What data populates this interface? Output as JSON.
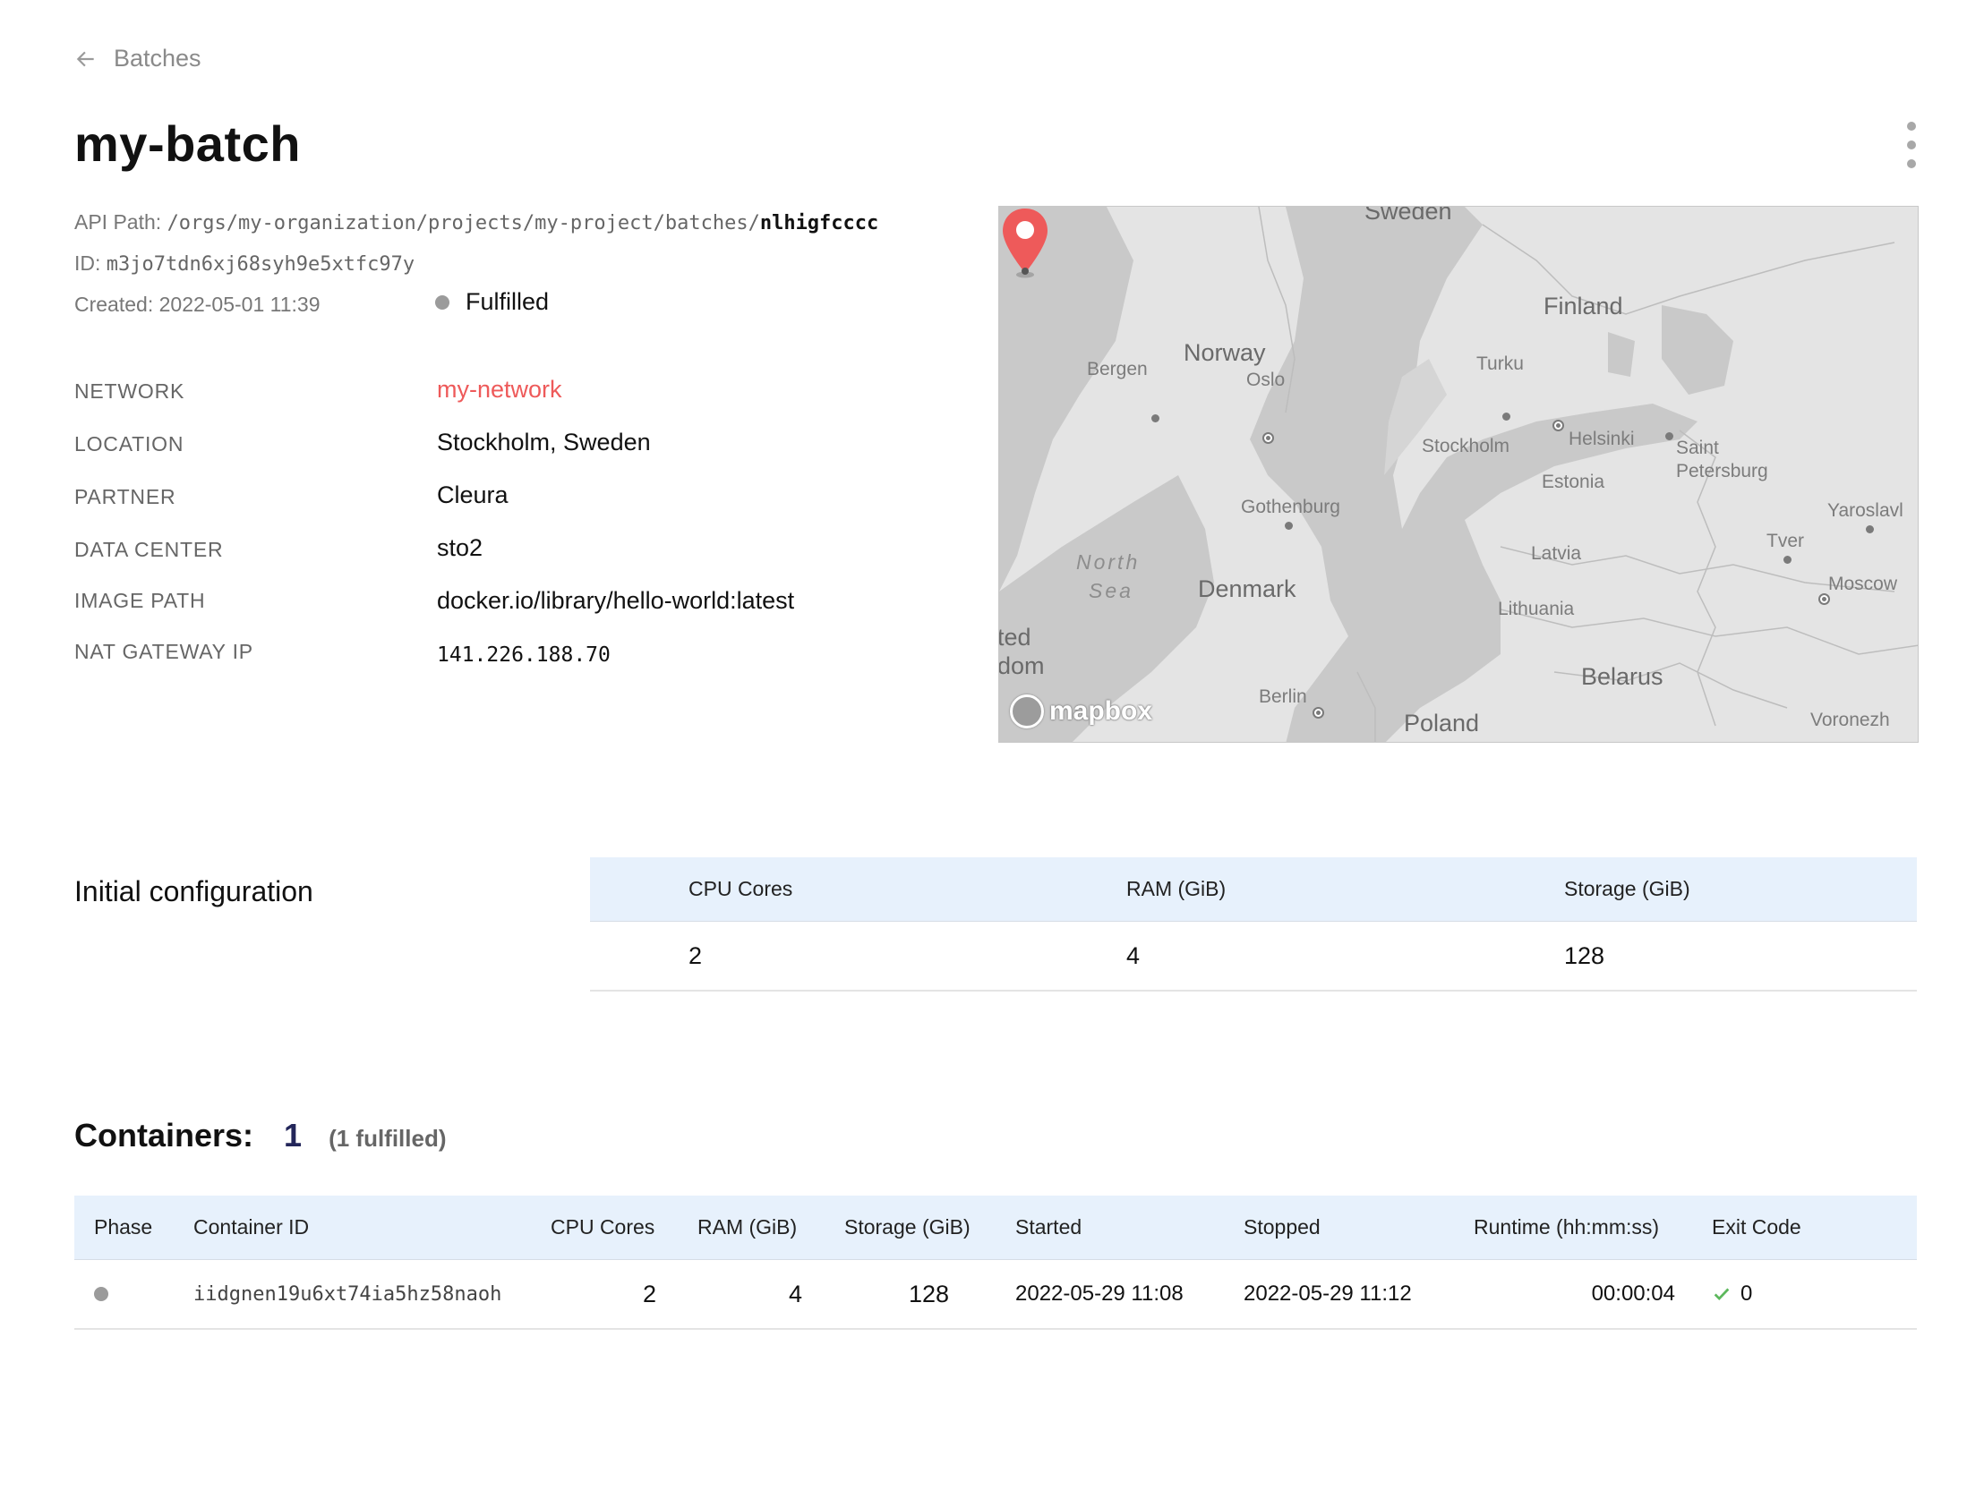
{
  "breadcrumb": {
    "back_label": "Batches"
  },
  "page": {
    "title": "my-batch"
  },
  "meta": {
    "api_path_label": "API Path:",
    "api_path_prefix": "/orgs/my-organization/projects/my-project/batches/",
    "api_path_id": "nlhigfcccc",
    "id_label": "ID:",
    "id_value": "m3jo7tdn6xj68syh9e5xtfc97y",
    "created": "Created: 2022-05-01 11:39",
    "status": "Fulfilled",
    "status_color": "#9b9b9b"
  },
  "properties": [
    {
      "label": "NETWORK",
      "value": "my-network"
    },
    {
      "label": "LOCATION",
      "value": "Stockholm, Sweden"
    },
    {
      "label": "PARTNER",
      "value": "Cleura"
    },
    {
      "label": "DATA CENTER",
      "value": "sto2"
    },
    {
      "label": "IMAGE PATH",
      "value": "docker.io/library/hello-world:latest"
    },
    {
      "label": "NAT GATEWAY IP",
      "value": "141.226.188.70"
    }
  ],
  "map": {
    "labels": {
      "sweden": "Sweden",
      "finland": "Finland",
      "norway": "Norway",
      "bergen": "Bergen",
      "oslo": "Oslo",
      "turku": "Turku",
      "helsinki": "Helsinki",
      "stockholm": "Stockholm",
      "saint": "Saint",
      "petersburg": "Petersburg",
      "estonia": "Estonia",
      "gothenburg": "Gothenburg",
      "yaroslavl": "Yaroslavl",
      "tver": "Tver",
      "latvia": "Latvia",
      "north": "North",
      "sea": "Sea",
      "denmark": "Denmark",
      "moscow": "Moscow",
      "lithuania": "Lithuania",
      "ted": "ted",
      "dom": "dom",
      "belarus": "Belarus",
      "berlin": "Berlin",
      "poland": "Poland",
      "voronezh": "Voronezh"
    },
    "logo_text": "mapbox",
    "marker_color": "#ee5a5a"
  },
  "initial_configuration": {
    "title": "Initial configuration",
    "headers": [
      "CPU Cores",
      "RAM (GiB)",
      "Storage (GiB)"
    ],
    "values": [
      "2",
      "4",
      "128"
    ]
  },
  "containers": {
    "title": "Containers:",
    "count": "1",
    "subtitle": "(1 fulfilled)",
    "headers": [
      "Phase",
      "Container ID",
      "CPU Cores",
      "RAM (GiB)",
      "Storage (GiB)",
      "Started",
      "Stopped",
      "Runtime (hh:mm:ss)",
      "Exit Code"
    ],
    "rows": [
      {
        "container_id": "iidgnen19u6xt74ia5hz58naoh",
        "cpu": "2",
        "ram": "4",
        "storage": "128",
        "started": "2022-05-29 11:08",
        "stopped": "2022-05-29 11:12",
        "runtime": "00:00:04",
        "exit_code": "0"
      }
    ],
    "success_color": "#5cb85c"
  }
}
